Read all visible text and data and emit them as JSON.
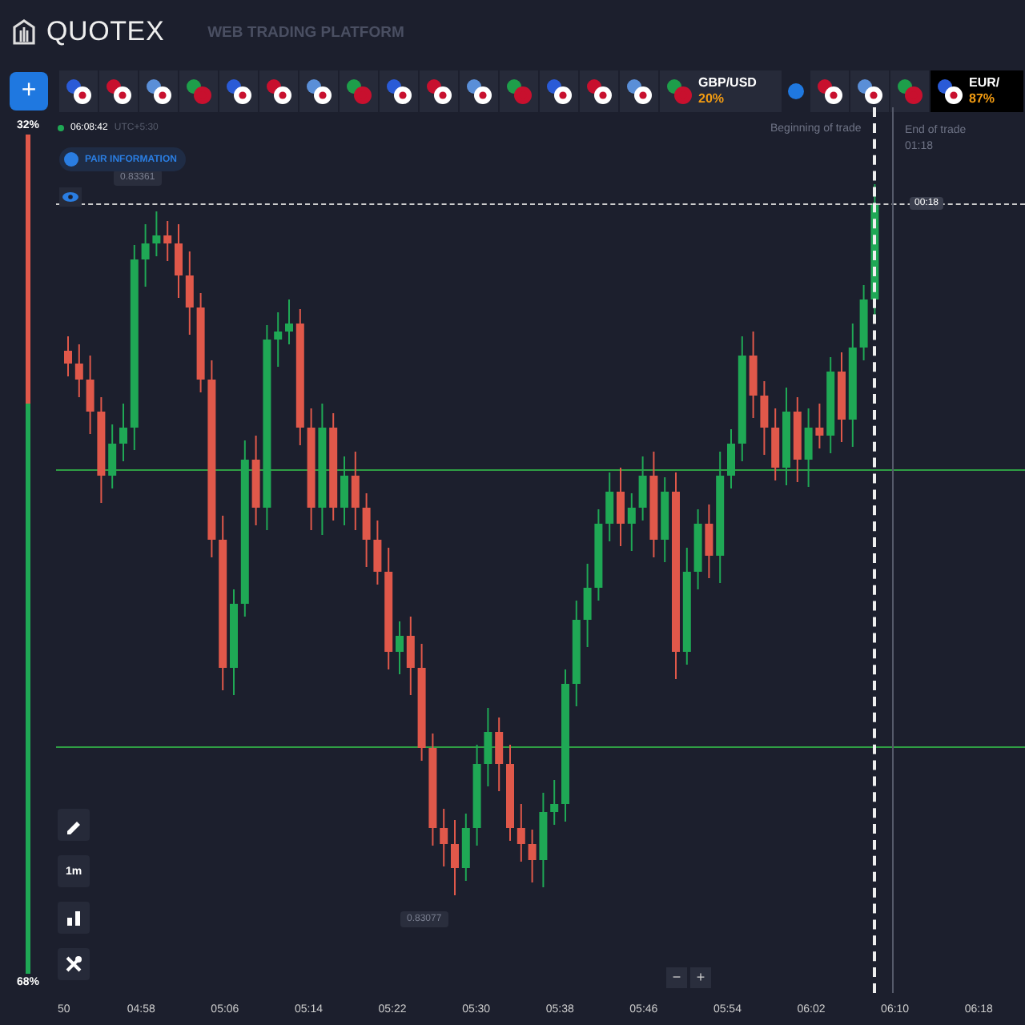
{
  "header": {
    "brand": "QUOTEX",
    "subtitle": "WEB TRADING PLATFORM"
  },
  "add_button": "+",
  "asset_tabs": [
    {
      "kind": "icon",
      "selected": false
    },
    {
      "kind": "icon",
      "selected": false
    },
    {
      "kind": "icon",
      "selected": false
    },
    {
      "kind": "icon",
      "selected": false
    },
    {
      "kind": "icon",
      "selected": false
    },
    {
      "kind": "icon",
      "selected": false
    },
    {
      "kind": "icon",
      "selected": false
    },
    {
      "kind": "icon",
      "selected": false
    },
    {
      "kind": "icon",
      "selected": false
    },
    {
      "kind": "icon",
      "selected": false
    },
    {
      "kind": "icon",
      "selected": false
    },
    {
      "kind": "icon",
      "selected": false
    },
    {
      "kind": "icon",
      "selected": false
    },
    {
      "kind": "icon",
      "selected": false
    },
    {
      "kind": "icon",
      "selected": false
    },
    {
      "kind": "named",
      "name": "GBP/USD",
      "payout": "20%",
      "selected": false
    },
    {
      "kind": "marker",
      "selected": false
    },
    {
      "kind": "icon",
      "selected": false
    },
    {
      "kind": "icon",
      "selected": false
    },
    {
      "kind": "icon",
      "selected": false
    },
    {
      "kind": "named",
      "name": "EUR/",
      "payout": "87%",
      "selected": true
    }
  ],
  "sentiment": {
    "sell_percent": "32%",
    "buy_percent": "68%",
    "level": 0.68
  },
  "chart": {
    "clock": "06:08:42",
    "timezone": "UTC+5:30",
    "pair_info_button": "PAIR INFORMATION",
    "high_price": "0.83361",
    "low_price": "0.83077",
    "timer": "00:18",
    "trade_start_label": "Beginning of trade",
    "trade_end_label": "End of trade",
    "trade_end_time": "01:18",
    "x_labels": [
      "50",
      "04:58",
      "05:06",
      "05:14",
      "05:22",
      "05:30",
      "05:38",
      "05:46",
      "05:54",
      "06:02",
      "06:10",
      "06:18"
    ],
    "tools": [
      {
        "kind": "pencil"
      },
      {
        "kind": "text",
        "label": "1m"
      },
      {
        "kind": "candles"
      },
      {
        "kind": "crossed"
      }
    ],
    "zoom_buttons": [
      "−",
      "+"
    ]
  }
}
